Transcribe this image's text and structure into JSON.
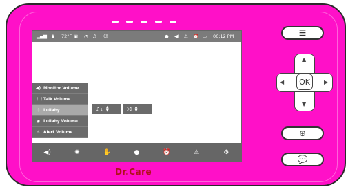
{
  "statusbar": {
    "signal_icon": "signal-bars",
    "temperature": "72°F",
    "time": "06:12 PM"
  },
  "menu": {
    "items": [
      {
        "icon": "◀)",
        "label": "Monitor Volume"
      },
      {
        "icon": "⋮⋮",
        "label": "Talk Volume"
      },
      {
        "icon": "♫",
        "label": "Lullaby"
      },
      {
        "icon": "◉",
        "label": "Lullaby Volume"
      },
      {
        "icon": "⚠",
        "label": "Alert Volume"
      }
    ],
    "selected_index": 2
  },
  "controls": {
    "music_icon": "♫",
    "shuffle_icon": "⤮"
  },
  "toolbar": {
    "items": [
      "speaker-icon",
      "brightness-icon",
      "hand-icon",
      "talk-icon",
      "alarm-icon",
      "alert-icon",
      "settings-icon"
    ]
  },
  "brand": {
    "text": "Dr.Care"
  },
  "buttons": {
    "ok_label": "OK"
  }
}
